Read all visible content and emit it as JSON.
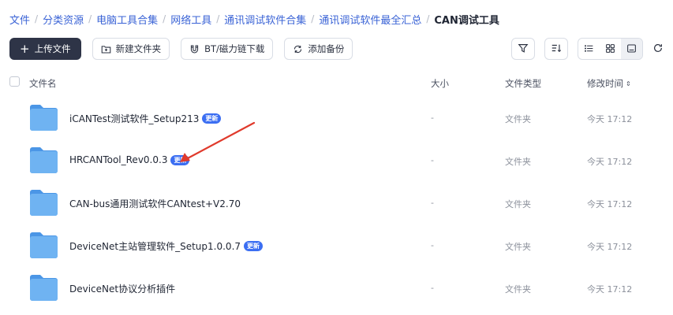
{
  "breadcrumb": [
    {
      "label": "文件"
    },
    {
      "label": "分类资源"
    },
    {
      "label": "电脑工具合集"
    },
    {
      "label": "网络工具"
    },
    {
      "label": "通讯调试软件合集"
    },
    {
      "label": "通讯调试软件最全汇总"
    },
    {
      "label": "CAN调试工具",
      "current": true
    }
  ],
  "breadcrumb_separator": "/",
  "toolbar": {
    "upload": {
      "plus": "+",
      "label": "上传文件"
    },
    "new_folder": {
      "label": "新建文件夹"
    },
    "bt_download": {
      "label": "BT/磁力链下载"
    },
    "add_backup": {
      "label": "添加备份"
    }
  },
  "table_header": {
    "name": "文件名",
    "size": "大小",
    "type": "文件类型",
    "modified": "修改时间",
    "sort_indicator": "⇕"
  },
  "files": [
    {
      "name": "iCANTest测试软件_Setup213",
      "badge": "更新",
      "size": "-",
      "type": "文件夹",
      "modified": "今天 17:12"
    },
    {
      "name": "HRCANTool_Rev0.0.3",
      "badge": "更新",
      "size": "-",
      "type": "文件夹",
      "modified": "今天 17:12"
    },
    {
      "name": "CAN-bus通用测试软件CANtest+V2.70",
      "badge": "",
      "size": "-",
      "type": "文件夹",
      "modified": "今天 17:12"
    },
    {
      "name": "DeviceNet主站管理软件_Setup1.0.0.7",
      "badge": "更新",
      "size": "-",
      "type": "文件夹",
      "modified": "今天 17:12"
    },
    {
      "name": "DeviceNet协议分析插件",
      "badge": "",
      "size": "-",
      "type": "文件夹",
      "modified": "今天 17:12"
    }
  ],
  "colors": {
    "link": "#3a63d6",
    "primary_button": "#2e3447",
    "badge": "#3b6ef2",
    "folder": "#5aa6ee",
    "annotation_arrow": "#e03a2c"
  },
  "icons": {
    "filter": "filter-icon",
    "sort": "sort-icon",
    "list_view": "list-view-icon",
    "grid_view": "grid-view-icon",
    "preview_view": "preview-view-icon",
    "refresh": "refresh-icon"
  }
}
